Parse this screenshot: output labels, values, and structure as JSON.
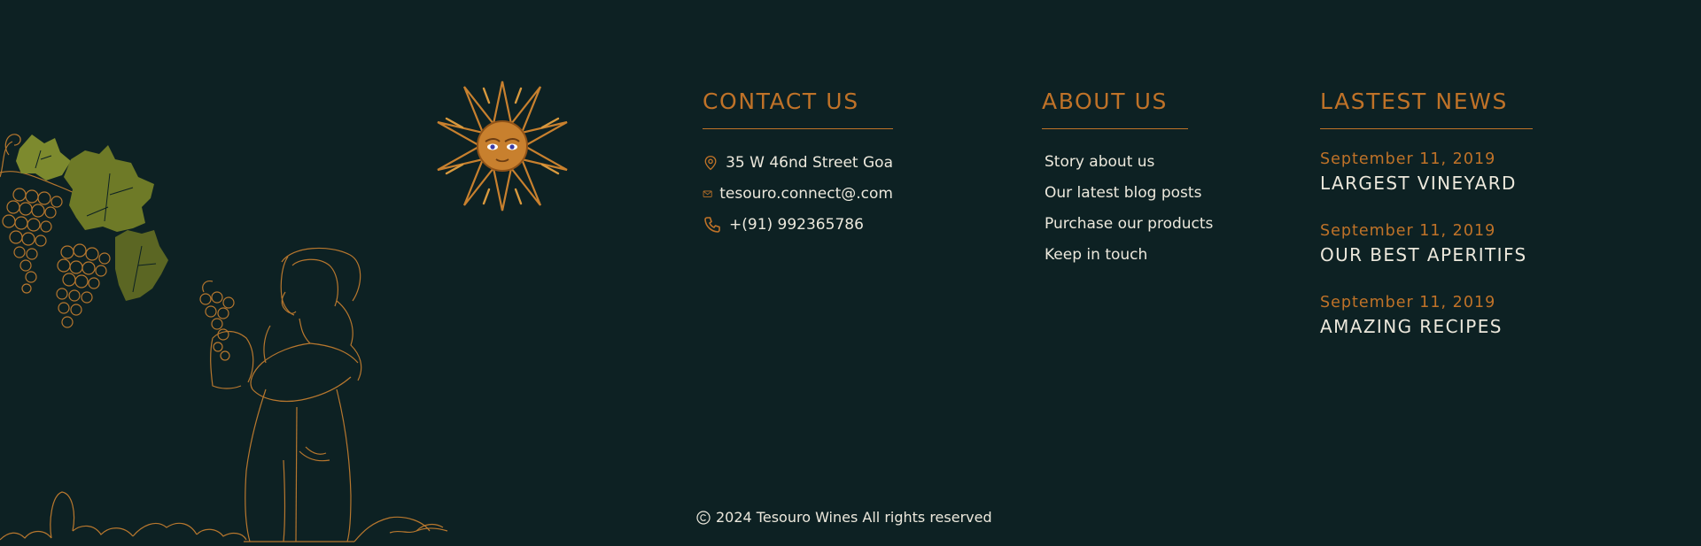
{
  "brand": {
    "colors": {
      "background": "#0d2123",
      "accent": "#bf7228",
      "text": "#ece8dc",
      "leaf": "#7d8a2e",
      "sun": "#c8802e"
    }
  },
  "contact": {
    "heading": "CONTACT US",
    "items": [
      {
        "icon": "location-pin-icon",
        "text": "35 W 46nd Street Goa"
      },
      {
        "icon": "mail-icon",
        "text": "tesouro.connect@.com"
      },
      {
        "icon": "phone-icon",
        "text": "+(91) 992365786"
      }
    ]
  },
  "about": {
    "heading": "ABOUT US",
    "links": [
      "Story about us",
      "Our latest blog posts",
      "Purchase our products",
      "Keep in touch"
    ]
  },
  "news": {
    "heading": "LASTEST NEWS",
    "items": [
      {
        "date": "September 11, 2019",
        "title": "LARGEST VINEYARD"
      },
      {
        "date": "September 11, 2019",
        "title": "OUR BEST APERITIFS"
      },
      {
        "date": "September 11, 2019",
        "title": "AMAZING RECIPES"
      }
    ]
  },
  "footer": {
    "copyright": "2024 Tesouro Wines All rights reserved"
  }
}
